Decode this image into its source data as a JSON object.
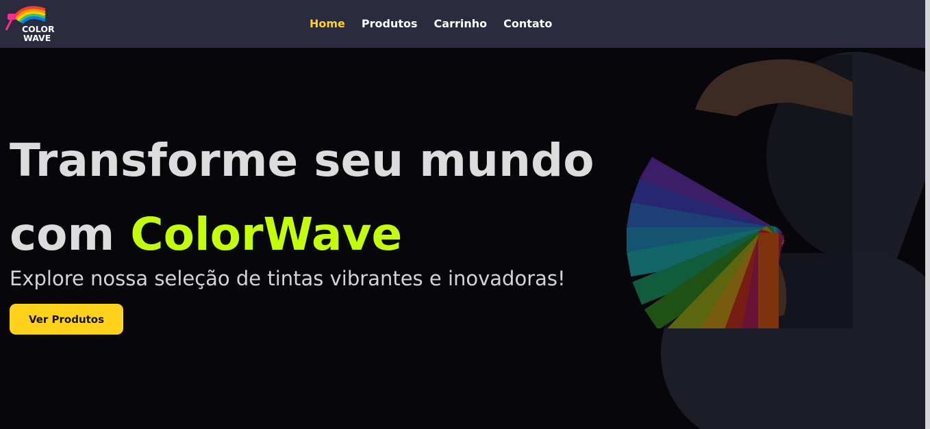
{
  "brand": {
    "logo_line1": "COLOR",
    "logo_line2": "WAVE"
  },
  "nav": {
    "items": [
      {
        "label": "Home",
        "active": true
      },
      {
        "label": "Produtos",
        "active": false
      },
      {
        "label": "Carrinho",
        "active": false
      },
      {
        "label": "Contato",
        "active": false
      }
    ]
  },
  "hero": {
    "headline_line1": "Transforme seu mundo",
    "headline_line2_prefix": "com ",
    "headline_accent": "ColorWave",
    "subtitle": "Explore nossa seleção de tintas vibrantes e inovadoras!",
    "cta_label": "Ver Produtos"
  },
  "colors": {
    "header_bg": "#2b2b40",
    "page_bg": "#07070b",
    "accent_yellow": "#ffd21a",
    "accent_green": "#c3ff00"
  },
  "icons": {
    "logo": "paint-roller-rainbow-icon",
    "hero_image": "color-swatch-fan-icon"
  }
}
